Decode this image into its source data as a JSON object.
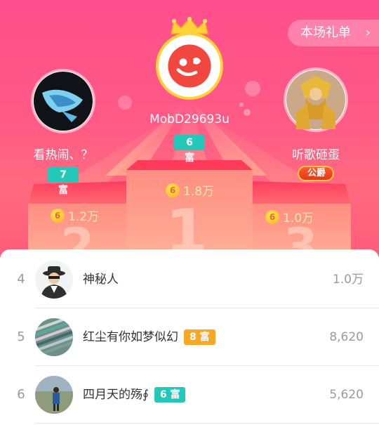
{
  "header": {
    "gift_list_label": "本场礼单",
    "chevron_icon": "chevron-right-icon"
  },
  "podium": {
    "first": {
      "name": "MobD29693u",
      "badge": "6 富",
      "amount": "1.8万",
      "coin_glyph": "6",
      "place_glyph": "1",
      "crown_icon": "crown-icon"
    },
    "second": {
      "name": "看热闹、？",
      "badge": "7 富",
      "amount": "1.2万",
      "coin_glyph": "6",
      "place_glyph": "2"
    },
    "third": {
      "name": "听歌砸蛋",
      "badge": "公爵",
      "amount": "1.0万",
      "coin_glyph": "6",
      "place_glyph": "3"
    }
  },
  "list": [
    {
      "rank": "4",
      "name": "神秘人",
      "badge": "",
      "value": "1.0万"
    },
    {
      "rank": "5",
      "name": "红尘有你如梦似幻",
      "badge": "8 富",
      "value": "8,620"
    },
    {
      "rank": "6",
      "name": "四月天的殇∮",
      "badge": "6 富",
      "value": "5,620"
    }
  ],
  "colors": {
    "background_pink": "#ff5a86",
    "badge_teal": "#23c8b8",
    "badge_orange": "#f8a726",
    "coin_gold": "#f8b51e"
  }
}
